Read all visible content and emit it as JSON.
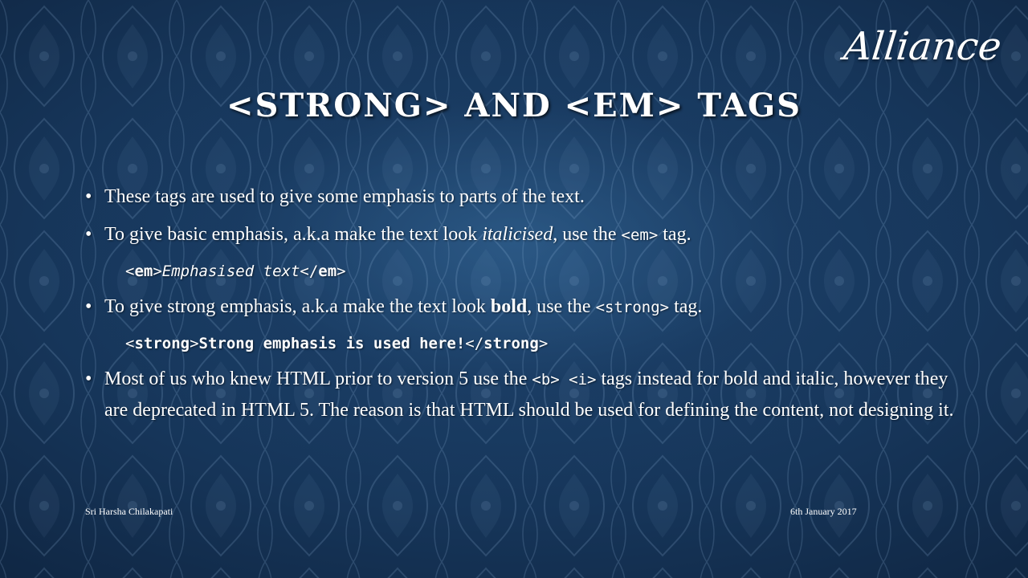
{
  "logo": "Alliance",
  "title": "<STRONG> AND <EM> TAGS",
  "bullets": [
    {
      "text": "These tags are used to give some emphasis to parts of the text."
    },
    {
      "before": "To give basic emphasis, a.k.a make the text look ",
      "emph": "italicised",
      "middle": ", use the ",
      "code": "<em>",
      "after": " tag.",
      "example": {
        "open_lt": "<",
        "open_tag": "em",
        "open_gt": ">",
        "content": "Emphasised text",
        "close_lt": "</",
        "close_tag": "em",
        "close_gt": ">"
      }
    },
    {
      "before": "To give strong emphasis, a.k.a make the text look ",
      "emph": "bold",
      "middle": ", use the ",
      "code": "<strong>",
      "after": " tag.",
      "example": {
        "open_lt": "<",
        "open_tag": "strong",
        "open_gt": ">",
        "content": "Strong emphasis is used here!",
        "close_lt": "</",
        "close_tag": "strong",
        "close_gt": ">"
      }
    },
    {
      "before": "Most of us who knew HTML prior to version 5 use the ",
      "code": "<b> <i>",
      "after": " tags instead for bold and italic, however they are deprecated in HTML 5. The reason is that HTML should be used for defining the content, not designing it."
    }
  ],
  "footer": {
    "author": "Sri Harsha Chilakapati",
    "date": "6th January 2017"
  }
}
